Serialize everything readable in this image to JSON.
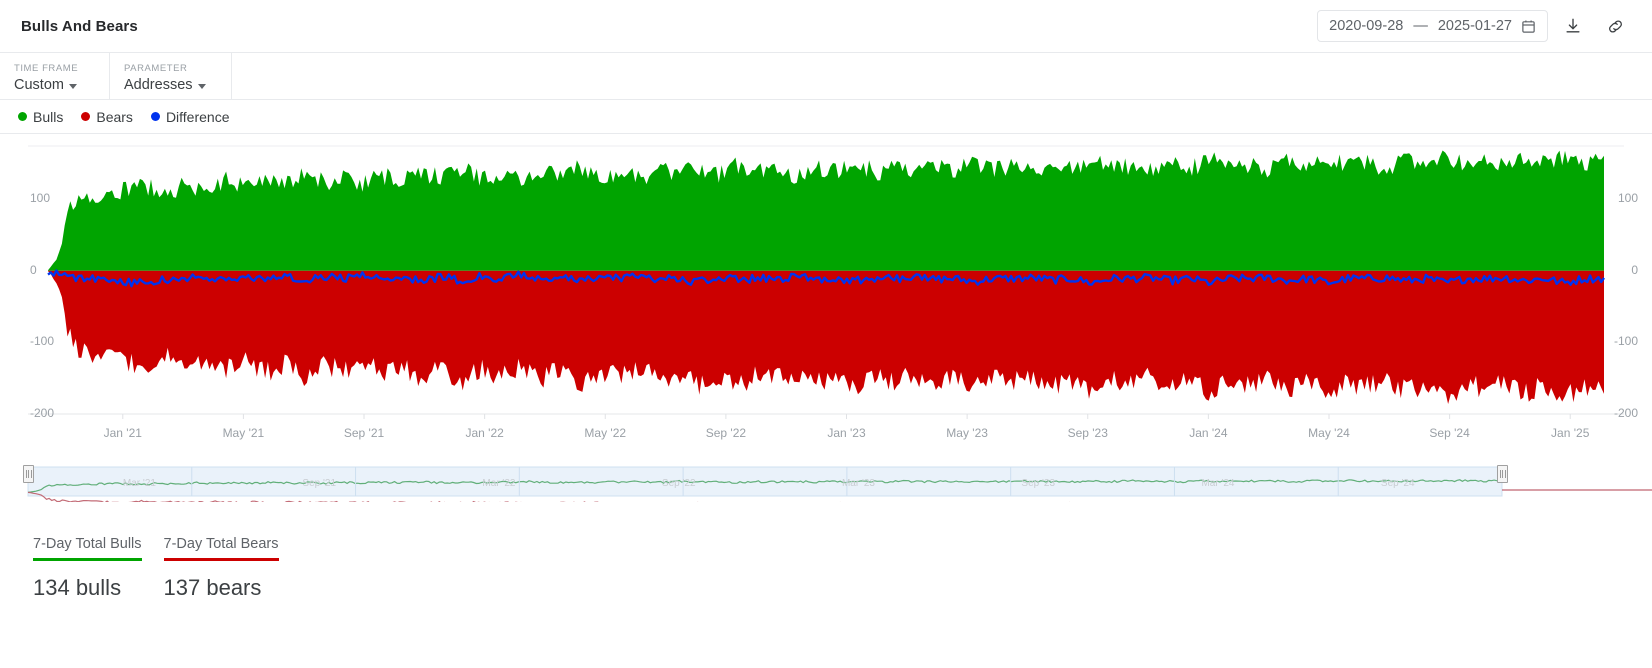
{
  "header": {
    "title": "Bulls And Bears",
    "date_range": {
      "start": "2020-09-28",
      "separator": "—",
      "end": "2025-01-27",
      "calendar_icon": "calendar-icon"
    },
    "download_icon": "download-icon",
    "link_icon": "link-icon"
  },
  "controls": [
    {
      "label": "TIME FRAME",
      "value": "Custom"
    },
    {
      "label": "PARAMETER",
      "value": "Addresses"
    }
  ],
  "legend": [
    {
      "label": "Bulls",
      "color": "#00A400"
    },
    {
      "label": "Bears",
      "color": "#CC0000"
    },
    {
      "label": "Difference",
      "color": "#0033EE"
    }
  ],
  "stats": [
    {
      "label": "7-Day Total Bulls",
      "value": "134 bulls",
      "color": "#00A400"
    },
    {
      "label": "7-Day Total Bears",
      "value": "137 bears",
      "color": "#CC0000"
    }
  ],
  "navigator": {
    "left_handle": "range-handle-left",
    "right_handle": "range-handle-right",
    "mini_labels": [
      "Mar '21",
      "Sep '21",
      "Mar '22",
      "Sep '22",
      "Mar '23",
      "Sep '23",
      "Mar '24",
      "Sep '24"
    ]
  },
  "chart_data": {
    "type": "area",
    "title": "Bulls And Bears",
    "xlabel": "",
    "ylabel": "",
    "ylim": [
      -200,
      160
    ],
    "yticks": [
      100,
      0,
      -100,
      -200
    ],
    "ytick_labels_left": [
      "100",
      "0",
      "-100",
      "-200"
    ],
    "ytick_labels_right": [
      "100",
      "0",
      "-100",
      "-200"
    ],
    "grid": false,
    "legend_position": "top-left",
    "xticks": [
      "Jan '21",
      "May '21",
      "Sep '21",
      "Jan '22",
      "May '22",
      "Sep '22",
      "Jan '23",
      "May '23",
      "Sep '23",
      "Jan '24",
      "May '24",
      "Sep '24",
      "Jan '25"
    ],
    "x_start": "2020-09-28",
    "x_end": "2025-01-27",
    "series": [
      {
        "name": "Bulls",
        "color": "#00A400",
        "type": "area",
        "values": [
          18,
          96,
          101,
          108,
          112,
          118,
          106,
          121,
          113,
          126,
          118,
          131,
          122,
          136,
          124,
          129,
          120,
          133,
          126,
          138,
          128,
          141,
          130,
          135,
          127,
          139,
          131,
          143,
          133,
          137,
          129,
          141,
          132,
          145,
          134,
          147,
          136,
          140,
          133,
          146,
          137,
          149,
          138,
          142,
          135,
          148,
          139,
          151,
          140,
          144,
          136,
          149,
          141,
          153,
          142,
          146,
          138,
          150,
          143,
          155,
          144,
          148,
          140,
          152,
          145,
          157,
          146,
          150,
          142,
          154,
          147,
          159,
          148,
          152,
          144,
          156,
          149,
          161,
          150,
          154
        ]
      },
      {
        "name": "Bears",
        "color": "#CC0000",
        "type": "area",
        "values": [
          -20,
          -104,
          -112,
          -120,
          -128,
          -136,
          -118,
          -131,
          -124,
          -139,
          -127,
          -143,
          -130,
          -148,
          -132,
          -140,
          -126,
          -145,
          -134,
          -152,
          -136,
          -155,
          -138,
          -147,
          -133,
          -150,
          -140,
          -158,
          -142,
          -148,
          -135,
          -153,
          -143,
          -161,
          -145,
          -159,
          -147,
          -151,
          -141,
          -157,
          -148,
          -163,
          -149,
          -153,
          -144,
          -160,
          -150,
          -166,
          -151,
          -155,
          -146,
          -162,
          -152,
          -170,
          -153,
          -157,
          -148,
          -164,
          -154,
          -172,
          -155,
          -159,
          -150,
          -166,
          -156,
          -174,
          -157,
          -161,
          -152,
          -168,
          -158,
          -176,
          -159,
          -163,
          -154,
          -170,
          -160,
          -178,
          -161,
          -165
        ]
      },
      {
        "name": "Difference",
        "color": "#0033EE",
        "type": "line",
        "values": [
          -2,
          -8,
          -11,
          -12,
          -16,
          -18,
          -12,
          -10,
          -11,
          -13,
          -9,
          -12,
          -8,
          -12,
          -8,
          -11,
          -6,
          -12,
          -8,
          -14,
          -8,
          -14,
          -8,
          -12,
          -6,
          -11,
          -9,
          -15,
          -9,
          -11,
          -6,
          -12,
          -11,
          -16,
          -11,
          -12,
          -11,
          -11,
          -8,
          -11,
          -11,
          -14,
          -11,
          -11,
          -9,
          -12,
          -11,
          -15,
          -11,
          -11,
          -10,
          -13,
          -11,
          -17,
          -11,
          -11,
          -10,
          -14,
          -11,
          -17,
          -11,
          -11,
          -10,
          -14,
          -11,
          -17,
          -11,
          -11,
          -10,
          -14,
          -11,
          -17,
          -11,
          -11,
          -10,
          -14,
          -11,
          -17,
          -11,
          -11
        ]
      }
    ]
  }
}
